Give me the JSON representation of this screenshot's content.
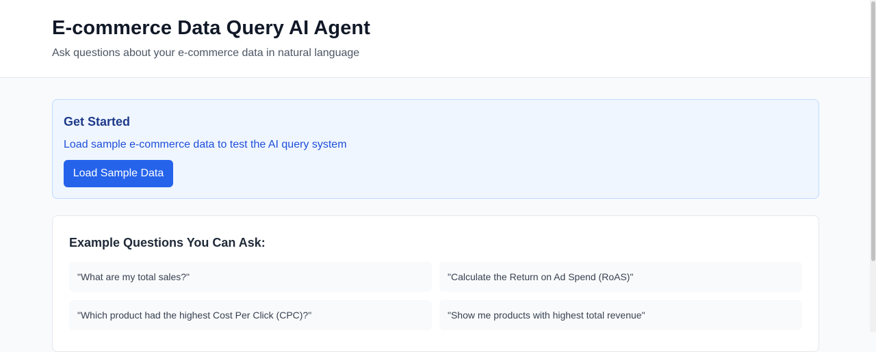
{
  "header": {
    "title": "E-commerce Data Query AI Agent",
    "subtitle": "Ask questions about your e-commerce data in natural language"
  },
  "get_started": {
    "title": "Get Started",
    "description": "Load sample e-commerce data to test the AI query system",
    "button_label": "Load Sample Data"
  },
  "examples": {
    "title": "Example Questions You Can Ask:",
    "items": [
      "\"What are my total sales?\"",
      "\"Calculate the Return on Ad Spend (RoAS)\"",
      "\"Which product had the highest Cost Per Click (CPC)?\"",
      "\"Show me products with highest total revenue\""
    ]
  },
  "colors": {
    "accent": "#2563eb",
    "panel_bg": "#eff6ff",
    "page_bg": "#f8fafc"
  }
}
